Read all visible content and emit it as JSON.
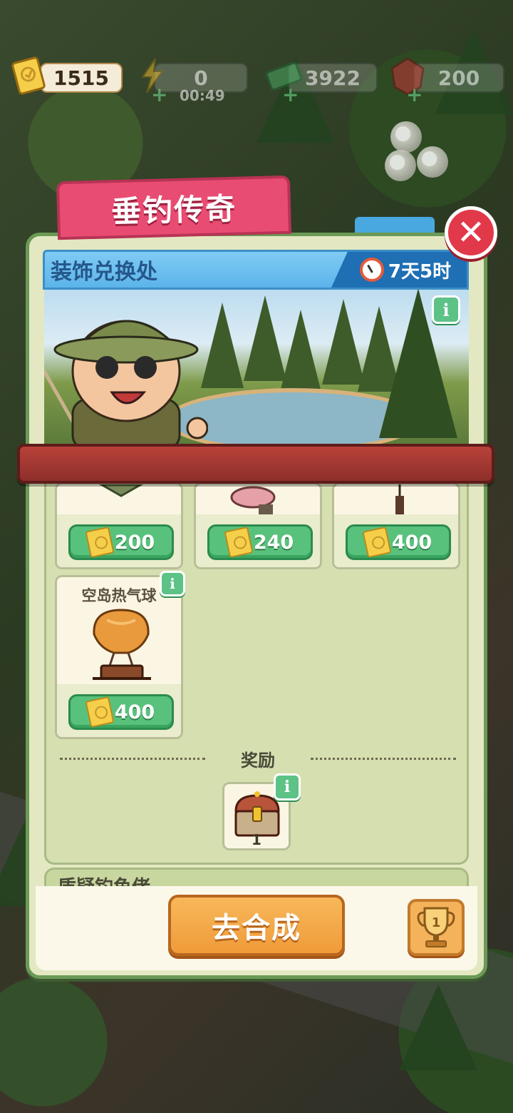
{
  "resources": {
    "tickets": {
      "value": "1515",
      "icon": "ticket-icon"
    },
    "energy": {
      "value": "0",
      "timer": "00:49",
      "icon": "lightning-icon"
    },
    "cash": {
      "value": "3922",
      "icon": "cash-icon"
    },
    "gems": {
      "value": "200",
      "icon": "ruby-icon"
    }
  },
  "modal": {
    "title": "垂钓传奇",
    "close_label": "✕",
    "section_title": "装饰兑换处",
    "time_left": "7天5时"
  },
  "shop": {
    "items": [
      {
        "name": "",
        "price": "200"
      },
      {
        "name": "",
        "price": "240"
      },
      {
        "name": "",
        "price": "400"
      },
      {
        "name": "空岛热气球",
        "price": "400"
      }
    ],
    "reward_label": "奖励",
    "reward_count": "1",
    "next_section_title": "质疑钓鱼佬"
  },
  "footer": {
    "go_button": "去合成",
    "trophy_count": "1"
  },
  "info_symbol": "i"
}
